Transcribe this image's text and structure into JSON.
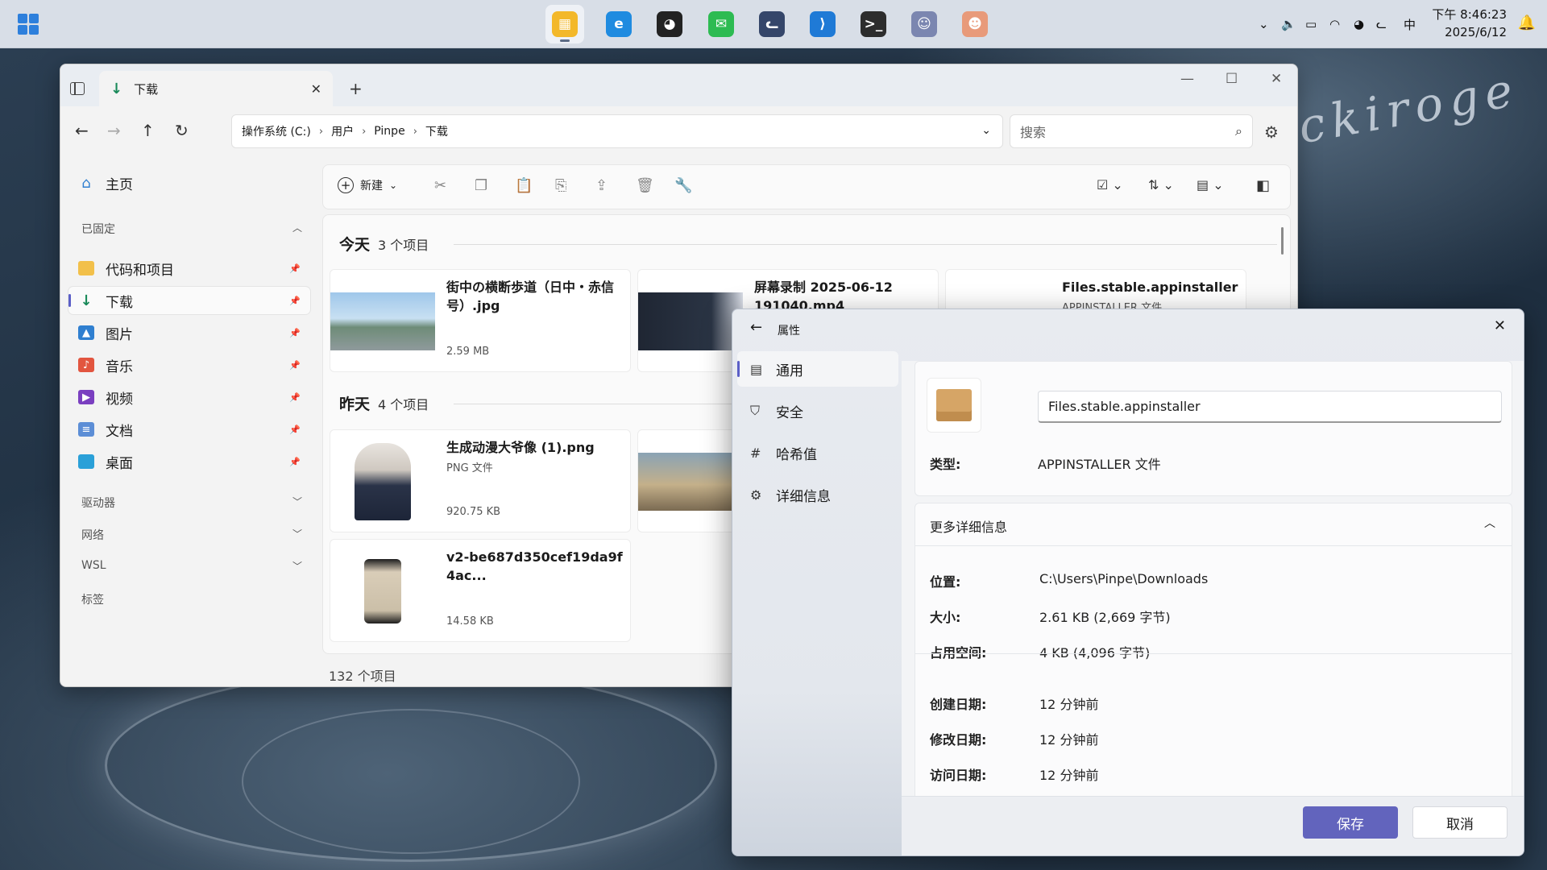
{
  "desktop": {
    "signature": "ckiroge"
  },
  "taskbar": {
    "apps": [
      {
        "name": "sticky-notes",
        "color": "#f3b82a",
        "glyph": "▦"
      },
      {
        "name": "edge",
        "color": "#1f8be0",
        "glyph": "e"
      },
      {
        "name": "qq",
        "color": "#222222",
        "glyph": "◕"
      },
      {
        "name": "wechat",
        "color": "#2dbb52",
        "glyph": "✉"
      },
      {
        "name": "cat-app",
        "color": "#35466a",
        "glyph": "ᓚ"
      },
      {
        "name": "vscode",
        "color": "#1f7ad6",
        "glyph": "⟩"
      },
      {
        "name": "terminal",
        "color": "#2d2d2d",
        "glyph": ">_"
      },
      {
        "name": "anime-app-1",
        "color": "#7b86b0",
        "glyph": "☺"
      },
      {
        "name": "anime-app-2",
        "color": "#e89a7a",
        "glyph": "☻"
      }
    ],
    "ime": "中",
    "time": "下午 8:46:23",
    "date": "2025/6/12"
  },
  "explorer": {
    "tab_title": "下载",
    "breadcrumb": [
      "操作系统 (C:)",
      "用户",
      "Pinpe",
      "下载"
    ],
    "search_placeholder": "搜索",
    "sidebar": {
      "home": "主页",
      "pinned_header": "已固定",
      "pinned": [
        {
          "label": "代码和项目",
          "icon": "folder-icon",
          "color": "#f2c04a",
          "glyph": ""
        },
        {
          "label": "下载",
          "icon": "download-icon",
          "color": "#1a8a5a",
          "glyph": "↓"
        },
        {
          "label": "图片",
          "icon": "pictures-icon",
          "color": "#2f7fd0",
          "glyph": "▲"
        },
        {
          "label": "音乐",
          "icon": "music-icon",
          "color": "#e2553f",
          "glyph": "♪"
        },
        {
          "label": "视频",
          "icon": "video-icon",
          "color": "#7a3fc0",
          "glyph": "▶"
        },
        {
          "label": "文档",
          "icon": "document-icon",
          "color": "#5c8ed6",
          "glyph": "≡"
        },
        {
          "label": "桌面",
          "icon": "desktop-icon",
          "color": "#2aa0d8",
          "glyph": ""
        }
      ],
      "sections": [
        "驱动器",
        "网络",
        "WSL",
        "标签"
      ]
    },
    "toolbar": {
      "new_label": "新建"
    },
    "groups": [
      {
        "title": "今天",
        "count": "3 个项目"
      },
      {
        "title": "昨天",
        "count": "4 个项目"
      }
    ],
    "files_today": [
      {
        "name": "街中の横断歩道（日中・赤信号）.jpg",
        "type": "",
        "size": "2.59 MB"
      },
      {
        "name": "屏幕录制 2025-06-12 191040.mp4",
        "type": "",
        "size": ""
      },
      {
        "name": "Files.stable.appinstaller",
        "type": "APPINSTALLER 文件",
        "size": ""
      }
    ],
    "files_yesterday": [
      {
        "name": "生成动漫大爷像 (1).png",
        "type": "PNG 文件",
        "size": "920.75 KB"
      },
      {
        "name": "v2-be687d350cef19da9f4ac...",
        "type": "",
        "size": "14.58 KB"
      }
    ],
    "status": "132 个项目"
  },
  "properties": {
    "title": "属性",
    "nav": [
      "通用",
      "安全",
      "哈希值",
      "详细信息"
    ],
    "file_name": "Files.stable.appinstaller",
    "type_label": "类型:",
    "type_value": "APPINSTALLER 文件",
    "more_details": "更多详细信息",
    "rows": [
      {
        "label": "位置:",
        "value": "C:\\Users\\Pinpe\\Downloads"
      },
      {
        "label": "大小:",
        "value": "2.61 KB (2,669 字节)"
      },
      {
        "label": "占用空间:",
        "value": "4 KB (4,096 字节)"
      },
      {
        "label": "创建日期:",
        "value": "12 分钟前"
      },
      {
        "label": "修改日期:",
        "value": "12 分钟前"
      },
      {
        "label": "访问日期:",
        "value": "12 分钟前"
      }
    ],
    "save": "保存",
    "cancel": "取消",
    "accent": "#6264bd"
  }
}
